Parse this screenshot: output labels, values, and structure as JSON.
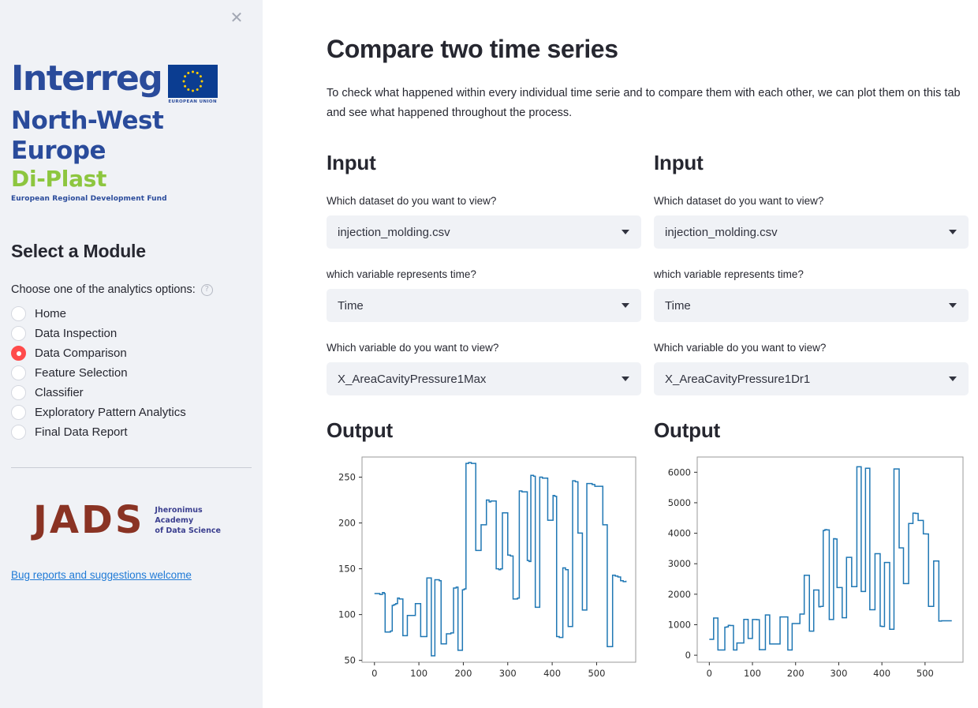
{
  "sidebar": {
    "close_label": "✕",
    "logo": {
      "interreg": "Interreg",
      "north_west_europe": "North-West Europe",
      "di_plast": "Di-Plast",
      "erdf": "European Regional Development Fund",
      "eu_caption": "EUROPEAN UNION",
      "flag_color": "#0b3d91",
      "star_color": "#ffcc00",
      "interreg_color": "#2a4b9b",
      "diplast_color": "#8dc63f"
    },
    "module_title": "Select a Module",
    "choose_label": "Choose one of the analytics options:",
    "help_icon_glyph": "?",
    "options": [
      {
        "label": "Home",
        "selected": false
      },
      {
        "label": "Data Inspection",
        "selected": false
      },
      {
        "label": "Data Comparison",
        "selected": true
      },
      {
        "label": "Feature Selection",
        "selected": false
      },
      {
        "label": "Classifier",
        "selected": false
      },
      {
        "label": "Exploratory Pattern Analytics",
        "selected": false
      },
      {
        "label": "Final Data Report",
        "selected": false
      }
    ],
    "selected_color": "#ff4b4b",
    "jads": {
      "mark": "JADS",
      "line1": "Jheronimus",
      "line2": "Academy",
      "line3": "of Data Science",
      "mark_color": "#8a3324"
    },
    "bug_link": "Bug reports and suggestions welcome"
  },
  "main": {
    "title": "Compare two time series",
    "description": "To check what happened within every individual time serie and to compare them with each other, we can plot them on this tab and see what happened throughout the process.",
    "left": {
      "input_heading": "Input",
      "output_heading": "Output",
      "dataset_label": "Which dataset do you want to view?",
      "dataset_value": "injection_molding.csv",
      "time_label": "which variable represents time?",
      "time_value": "Time",
      "variable_label": "Which variable do you want to view?",
      "variable_value": "X_AreaCavityPressure1Max"
    },
    "right": {
      "input_heading": "Input",
      "output_heading": "Output",
      "dataset_label": "Which dataset do you want to view?",
      "dataset_value": "injection_molding.csv",
      "time_label": "which variable represents time?",
      "time_value": "Time",
      "variable_label": "Which variable do you want to view?",
      "variable_value": "X_AreaCavityPressure1Dr1"
    }
  },
  "chart_data": [
    {
      "type": "line",
      "name": "left-chart",
      "title": "",
      "xlabel": "",
      "ylabel": "",
      "series_name": "X_AreaCavityPressure1Max",
      "line_color": "#1f77b4",
      "grid": false,
      "legend": false,
      "xlim": [
        -28,
        588
      ],
      "ylim": [
        48,
        272
      ],
      "xticks": [
        0,
        100,
        200,
        300,
        400,
        500
      ],
      "yticks": [
        50,
        100,
        150,
        200,
        250
      ],
      "x": [
        0,
        6,
        12,
        18,
        22,
        24,
        30,
        36,
        40,
        44,
        48,
        52,
        56,
        60,
        64,
        68,
        74,
        80,
        86,
        92,
        96,
        100,
        104,
        108,
        112,
        118,
        124,
        128,
        132,
        136,
        142,
        146,
        150,
        156,
        162,
        168,
        172,
        178,
        184,
        188,
        192,
        198,
        202,
        206,
        212,
        218,
        224,
        228,
        234,
        240,
        246,
        252,
        258,
        262,
        268,
        274,
        280,
        284,
        288,
        294,
        300,
        306,
        312,
        318,
        322,
        326,
        332,
        338,
        344,
        348,
        352,
        358,
        362,
        368,
        372,
        378,
        384,
        390,
        396,
        402,
        406,
        410,
        416,
        420,
        424,
        430,
        436,
        442,
        446,
        452,
        458,
        464,
        468,
        474,
        478,
        484,
        490,
        496,
        502,
        508,
        514,
        520,
        524,
        530,
        536,
        542,
        548,
        554,
        560,
        566
      ],
      "y": [
        123,
        123,
        122,
        124,
        123,
        81,
        81,
        82,
        110,
        111,
        112,
        118,
        117,
        117,
        77,
        77,
        99,
        99,
        99,
        112,
        112,
        112,
        76,
        76,
        76,
        140,
        140,
        55,
        55,
        138,
        138,
        137,
        68,
        68,
        79,
        79,
        80,
        129,
        130,
        61,
        61,
        127,
        128,
        265,
        266,
        265,
        265,
        170,
        170,
        198,
        198,
        225,
        223,
        224,
        224,
        150,
        149,
        150,
        211,
        211,
        165,
        164,
        117,
        117,
        118,
        235,
        234,
        234,
        159,
        158,
        252,
        251,
        108,
        108,
        250,
        249,
        249,
        203,
        203,
        230,
        229,
        76,
        75,
        75,
        151,
        149,
        87,
        87,
        246,
        245,
        189,
        189,
        105,
        105,
        243,
        243,
        242,
        240,
        240,
        240,
        198,
        198,
        65,
        65,
        143,
        142,
        141,
        137,
        136,
        137
      ]
    },
    {
      "type": "line",
      "name": "right-chart",
      "title": "",
      "xlabel": "",
      "ylabel": "",
      "series_name": "X_AreaCavityPressure1Dr1",
      "line_color": "#1f77b4",
      "grid": false,
      "legend": false,
      "xlim": [
        -28,
        588
      ],
      "ylim": [
        -230,
        6500
      ],
      "xticks": [
        0,
        100,
        200,
        300,
        400,
        500
      ],
      "yticks": [
        0,
        1000,
        2000,
        3000,
        4000,
        5000,
        6000
      ],
      "x": [
        0,
        6,
        10,
        14,
        20,
        24,
        30,
        36,
        40,
        44,
        48,
        52,
        56,
        60,
        64,
        68,
        74,
        80,
        86,
        90,
        94,
        100,
        104,
        110,
        116,
        120,
        124,
        130,
        136,
        140,
        146,
        152,
        158,
        164,
        170,
        176,
        182,
        188,
        192,
        198,
        204,
        210,
        216,
        220,
        226,
        232,
        238,
        242,
        248,
        254,
        258,
        264,
        268,
        272,
        278,
        284,
        288,
        292,
        296,
        302,
        308,
        314,
        318,
        324,
        330,
        336,
        342,
        348,
        352,
        358,
        362,
        368,
        372,
        378,
        384,
        390,
        396,
        400,
        406,
        412,
        418,
        422,
        428,
        434,
        440,
        446,
        450,
        456,
        462,
        468,
        472,
        478,
        484,
        490,
        496,
        502,
        508,
        514,
        520,
        526,
        532,
        538,
        544,
        550,
        556,
        562
      ],
      "y": [
        520,
        520,
        1220,
        1220,
        170,
        170,
        170,
        920,
        930,
        980,
        975,
        975,
        170,
        170,
        400,
        400,
        400,
        1175,
        1175,
        550,
        550,
        1170,
        1170,
        1165,
        180,
        180,
        180,
        1320,
        1320,
        370,
        370,
        370,
        370,
        1255,
        1255,
        1255,
        170,
        170,
        1040,
        1040,
        1040,
        1350,
        1350,
        2620,
        2620,
        790,
        790,
        2140,
        2140,
        1590,
        1600,
        4090,
        4120,
        4110,
        1170,
        1170,
        3820,
        3810,
        2220,
        2220,
        1230,
        1230,
        3210,
        3210,
        2250,
        2250,
        6180,
        6180,
        2090,
        2090,
        6130,
        6130,
        1490,
        1490,
        3330,
        3330,
        950,
        940,
        3040,
        3040,
        850,
        850,
        6110,
        6110,
        3520,
        3520,
        2350,
        2350,
        4320,
        4320,
        4660,
        4650,
        4420,
        4420,
        3980,
        3975,
        1600,
        1600,
        3090,
        3090,
        1120,
        1130,
        1130,
        1130,
        1130
      ]
    }
  ]
}
